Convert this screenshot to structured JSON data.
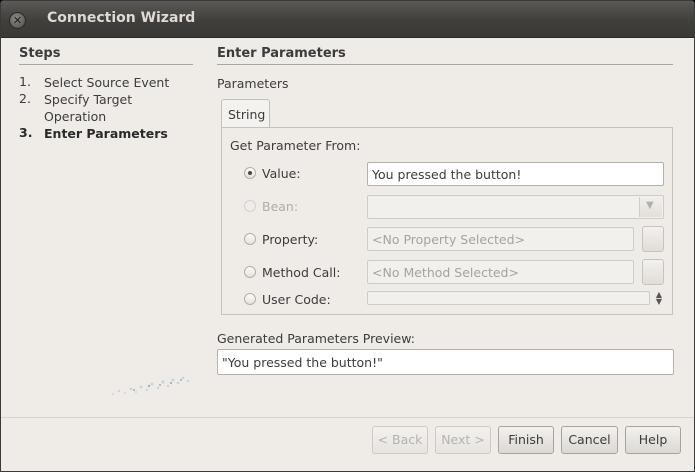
{
  "window": {
    "title": "Connection Wizard"
  },
  "steps": {
    "heading": "Steps",
    "items": [
      {
        "num": "1.",
        "label_line1": "Select Source Event",
        "label_line2": ""
      },
      {
        "num": "2.",
        "label_line1": "Specify Target",
        "label_line2": "Operation"
      },
      {
        "num": "3.",
        "label_line1": "Enter Parameters",
        "label_line2": ""
      }
    ]
  },
  "main": {
    "heading": "Enter Parameters",
    "parameters_label": "Parameters",
    "tab": "String",
    "get_from_label": "Get Parameter From:",
    "options": {
      "value": {
        "label": "Value:",
        "field": "You pressed the button!"
      },
      "bean": {
        "label": "Bean:",
        "field": ""
      },
      "property": {
        "label": "Property:",
        "field": "<No Property Selected>"
      },
      "method": {
        "label": "Method Call:",
        "field": "<No Method Selected>"
      },
      "usercode": {
        "label": "User Code:",
        "field": ""
      }
    },
    "preview_label": "Generated Parameters Preview:",
    "preview_value": "\"You pressed the button!\""
  },
  "buttons": {
    "back": "< Back",
    "next": "Next >",
    "finish": "Finish",
    "cancel": "Cancel",
    "help": "Help"
  }
}
